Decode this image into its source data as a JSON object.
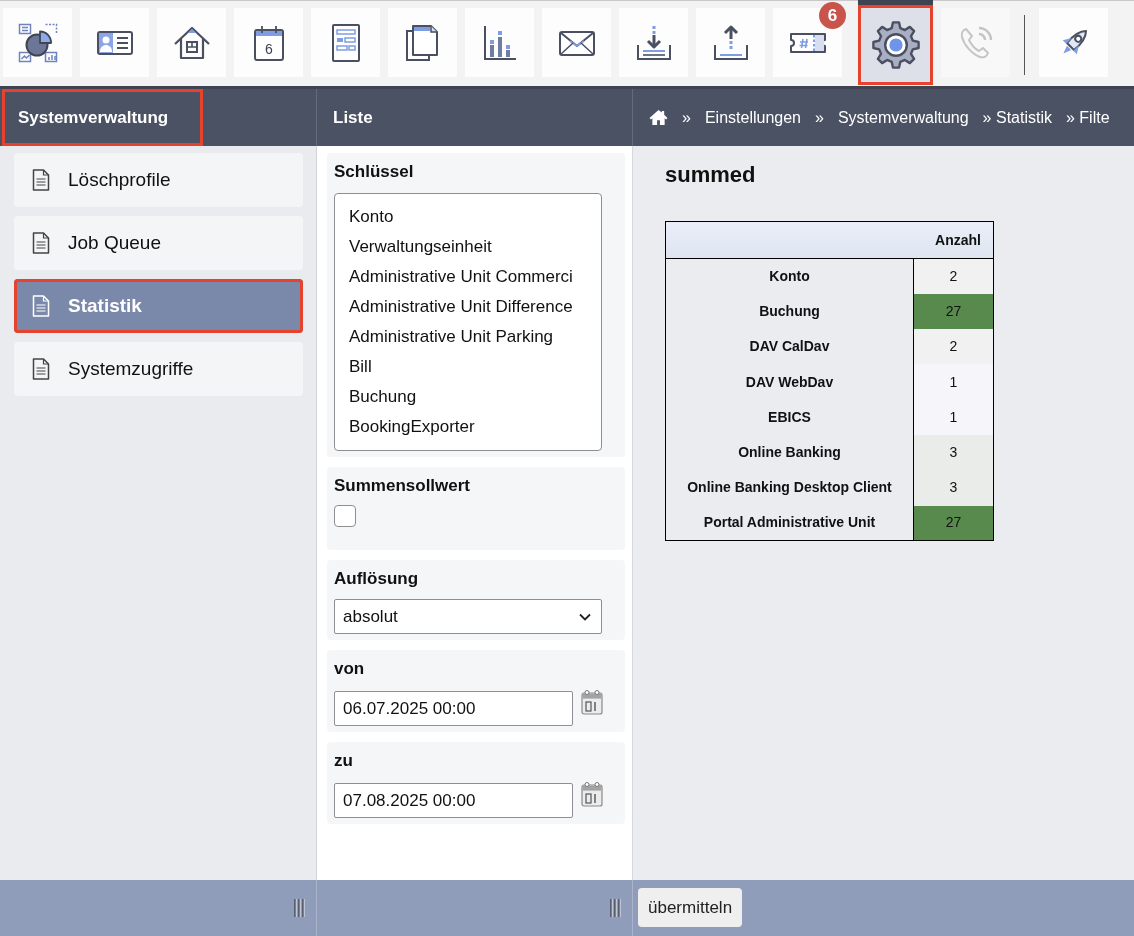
{
  "toolbar": {
    "items": [
      {
        "kind": "dashboard",
        "selected": false,
        "disabled": false,
        "highlighted": false
      },
      {
        "kind": "contact",
        "selected": false,
        "disabled": false,
        "highlighted": false
      },
      {
        "kind": "house",
        "selected": false,
        "disabled": false,
        "highlighted": false
      },
      {
        "kind": "calendar",
        "day": "6",
        "selected": false,
        "disabled": false,
        "highlighted": false
      },
      {
        "kind": "form",
        "selected": false,
        "disabled": false,
        "highlighted": false
      },
      {
        "kind": "documents",
        "selected": false,
        "disabled": false,
        "highlighted": false
      },
      {
        "kind": "chart",
        "selected": false,
        "disabled": false,
        "highlighted": false
      },
      {
        "kind": "mail",
        "selected": false,
        "disabled": false,
        "highlighted": false
      },
      {
        "kind": "import",
        "selected": false,
        "disabled": false,
        "highlighted": false
      },
      {
        "kind": "export",
        "selected": false,
        "disabled": false,
        "highlighted": false
      },
      {
        "kind": "ticket",
        "badge": "6",
        "selected": false,
        "disabled": false,
        "highlighted": false
      },
      {
        "kind": "settings",
        "selected": true,
        "disabled": false,
        "highlighted": true
      },
      {
        "kind": "phone",
        "selected": false,
        "disabled": true,
        "highlighted": false
      },
      {
        "kind": "divider"
      },
      {
        "kind": "rocket",
        "selected": false,
        "disabled": false,
        "highlighted": false
      }
    ]
  },
  "sidebar": {
    "title": "Systemverwaltung",
    "title_highlighted": true,
    "items": [
      {
        "label": "Löschprofile",
        "selected": false,
        "highlighted": false
      },
      {
        "label": "Job Queue",
        "selected": false,
        "highlighted": false
      },
      {
        "label": "Statistik",
        "selected": true,
        "highlighted": true
      },
      {
        "label": "Systemzugriffe",
        "selected": false,
        "highlighted": false
      }
    ]
  },
  "form": {
    "title": "Liste",
    "fields": [
      {
        "kind": "listbox",
        "label": "Schlüssel",
        "options": [
          {
            "text": "Konto",
            "selected": false
          },
          {
            "text": "Verwaltungseinheit",
            "selected": false
          },
          {
            "text": "Administrative Unit Commerci",
            "selected": false
          },
          {
            "text": "Administrative Unit Difference",
            "selected": false
          },
          {
            "text": "Administrative Unit Parking",
            "selected": false
          },
          {
            "text": "Bill",
            "selected": false
          },
          {
            "text": "Buchung",
            "selected": false
          },
          {
            "text": "BookingExporter",
            "selected": false
          }
        ]
      },
      {
        "kind": "checkbox",
        "label": "Summensollwert",
        "checked": false
      },
      {
        "kind": "select",
        "label": "Auflösung",
        "value": "absolut"
      },
      {
        "kind": "datetime",
        "label": "von",
        "value": "06.07.2025 00:00"
      },
      {
        "kind": "datetime",
        "label": "zu",
        "value": "07.08.2025 00:00"
      }
    ]
  },
  "breadcrumb": {
    "items": [
      "»",
      "Einstellungen",
      "»",
      "Systemverwaltung",
      "» Statistik",
      "» Filte"
    ]
  },
  "result": {
    "title": "summed",
    "table": {
      "header": "Anzahl",
      "rows": [
        {
          "label": "Konto",
          "value": "2",
          "color": "#f1f1f1"
        },
        {
          "label": "Buchung",
          "value": "27",
          "color": "#588a4e"
        },
        {
          "label": "DAV CalDav",
          "value": "2",
          "color": "#f1f1f1"
        },
        {
          "label": "DAV WebDav",
          "value": "1",
          "color": "#f6f5f9"
        },
        {
          "label": "EBICS",
          "value": "1",
          "color": "#f6f5f9"
        },
        {
          "label": "Online Banking",
          "value": "3",
          "color": "#eaece9"
        },
        {
          "label": "Online Banking Desktop Client",
          "value": "3",
          "color": "#eaece9"
        },
        {
          "label": "Portal Administrative Unit",
          "value": "27",
          "color": "#588a4e"
        }
      ]
    }
  },
  "footer": {
    "submit": "übermitteln"
  }
}
